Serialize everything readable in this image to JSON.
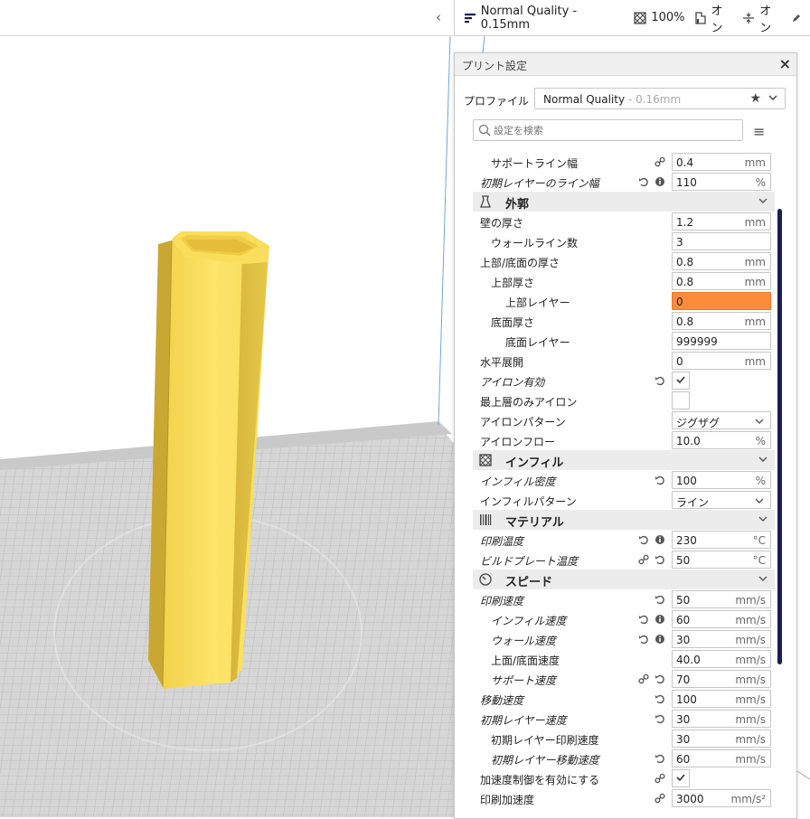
{
  "topbar": {
    "profile": "Normal Quality - 0.15mm",
    "infill": "100%",
    "support": "オン",
    "adhesion": "オン"
  },
  "panel": {
    "title": "プリント設定",
    "profile_label": "プロファイル",
    "profile_name": "Normal Quality",
    "profile_sub": " - 0.16mm",
    "search_placeholder": "設定を検索"
  },
  "settings": [
    {
      "type": "row",
      "label": "サポートライン幅",
      "indent": 1,
      "italic": false,
      "icons": [
        "link"
      ],
      "value": "0.4",
      "unit": "mm"
    },
    {
      "type": "row",
      "label": "初期レイヤーのライン幅",
      "indent": 0,
      "italic": true,
      "icons": [
        "reset",
        "info"
      ],
      "value": "110",
      "unit": "%"
    },
    {
      "type": "category",
      "label": "外郭",
      "icon": "shell-icon"
    },
    {
      "type": "row",
      "label": "壁の厚さ",
      "indent": 0,
      "italic": false,
      "icons": [],
      "value": "1.2",
      "unit": "mm"
    },
    {
      "type": "row",
      "label": "ウォールライン数",
      "indent": 1,
      "italic": false,
      "icons": [],
      "value": "3",
      "unit": ""
    },
    {
      "type": "row",
      "label": "上部/底面の厚さ",
      "indent": 0,
      "italic": false,
      "icons": [],
      "value": "0.8",
      "unit": "mm"
    },
    {
      "type": "row",
      "label": "上部厚さ",
      "indent": 1,
      "italic": false,
      "icons": [],
      "value": "0.8",
      "unit": "mm"
    },
    {
      "type": "row",
      "label": "上部レイヤー",
      "indent": 2,
      "italic": false,
      "icons": [],
      "value": "0",
      "unit": "",
      "error": true
    },
    {
      "type": "row",
      "label": "底面厚さ",
      "indent": 1,
      "italic": false,
      "icons": [],
      "value": "0.8",
      "unit": "mm"
    },
    {
      "type": "row",
      "label": "底面レイヤー",
      "indent": 2,
      "italic": false,
      "icons": [],
      "value": "999999",
      "unit": ""
    },
    {
      "type": "row",
      "label": "水平展開",
      "indent": 0,
      "italic": false,
      "icons": [],
      "value": "0",
      "unit": "mm"
    },
    {
      "type": "checkbox",
      "label": "アイロン有効",
      "indent": 0,
      "italic": true,
      "icons": [
        "reset"
      ],
      "checked": true
    },
    {
      "type": "checkbox",
      "label": "最上層のみアイロン",
      "indent": 0,
      "italic": false,
      "icons": [],
      "checked": false
    },
    {
      "type": "select",
      "label": "アイロンパターン",
      "indent": 0,
      "italic": false,
      "icons": [],
      "value": "ジグザグ"
    },
    {
      "type": "row",
      "label": "アイロンフロー",
      "indent": 0,
      "italic": false,
      "icons": [],
      "value": "10.0",
      "unit": "%"
    },
    {
      "type": "category",
      "label": "インフィル",
      "icon": "infill-icon"
    },
    {
      "type": "row",
      "label": "インフィル密度",
      "indent": 0,
      "italic": true,
      "icons": [
        "reset"
      ],
      "value": "100",
      "unit": "%"
    },
    {
      "type": "select",
      "label": "インフィルパターン",
      "indent": 0,
      "italic": false,
      "icons": [],
      "value": "ライン"
    },
    {
      "type": "category",
      "label": "マテリアル",
      "icon": "material-icon"
    },
    {
      "type": "row",
      "label": "印刷温度",
      "indent": 0,
      "italic": true,
      "icons": [
        "reset",
        "info"
      ],
      "value": "230",
      "unit": "°C"
    },
    {
      "type": "row",
      "label": "ビルドプレート温度",
      "indent": 0,
      "italic": true,
      "icons": [
        "link",
        "reset"
      ],
      "value": "50",
      "unit": "°C"
    },
    {
      "type": "category",
      "label": "スピード",
      "icon": "speed-icon"
    },
    {
      "type": "row",
      "label": "印刷速度",
      "indent": 0,
      "italic": true,
      "icons": [
        "reset"
      ],
      "value": "50",
      "unit": "mm/s"
    },
    {
      "type": "row",
      "label": "インフィル速度",
      "indent": 1,
      "italic": true,
      "icons": [
        "reset",
        "info"
      ],
      "value": "60",
      "unit": "mm/s"
    },
    {
      "type": "row",
      "label": "ウォール速度",
      "indent": 1,
      "italic": true,
      "icons": [
        "reset",
        "info"
      ],
      "value": "30",
      "unit": "mm/s"
    },
    {
      "type": "row",
      "label": "上面/底面速度",
      "indent": 1,
      "italic": false,
      "icons": [],
      "value": "40.0",
      "unit": "mm/s"
    },
    {
      "type": "row",
      "label": "サポート速度",
      "indent": 1,
      "italic": true,
      "icons": [
        "link",
        "reset"
      ],
      "value": "70",
      "unit": "mm/s"
    },
    {
      "type": "row",
      "label": "移動速度",
      "indent": 0,
      "italic": true,
      "icons": [
        "reset"
      ],
      "value": "100",
      "unit": "mm/s"
    },
    {
      "type": "row",
      "label": "初期レイヤー速度",
      "indent": 0,
      "italic": true,
      "icons": [
        "reset"
      ],
      "value": "30",
      "unit": "mm/s"
    },
    {
      "type": "row",
      "label": "初期レイヤー印刷速度",
      "indent": 1,
      "italic": false,
      "icons": [],
      "value": "30",
      "unit": "mm/s"
    },
    {
      "type": "row",
      "label": "初期レイヤー移動速度",
      "indent": 1,
      "italic": true,
      "icons": [
        "reset"
      ],
      "value": "60",
      "unit": "mm/s"
    },
    {
      "type": "checkbox",
      "label": "加速度制御を有効にする",
      "indent": 0,
      "italic": false,
      "icons": [
        "link"
      ],
      "checked": true
    },
    {
      "type": "row",
      "label": "印刷加速度",
      "indent": 0,
      "italic": false,
      "icons": [
        "link"
      ],
      "value": "3000",
      "unit": "mm/s²"
    }
  ],
  "colors": {
    "model": "#f7df5c",
    "error_field": "#fb8c3c",
    "scrollbar": "#1a1f4e",
    "category_bg": "#ececec"
  }
}
